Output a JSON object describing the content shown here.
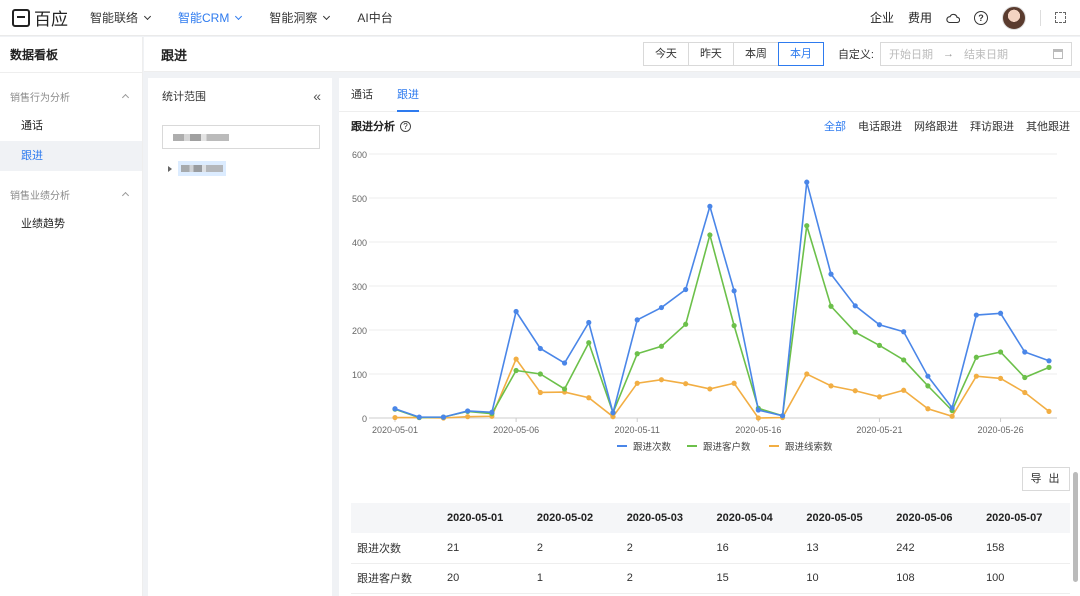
{
  "app": {
    "logo_text": "百应",
    "nav": [
      {
        "label": "智能联络",
        "active": false
      },
      {
        "label": "智能CRM",
        "active": true
      },
      {
        "label": "智能洞察",
        "active": false
      },
      {
        "label": "AI中台",
        "active": false
      }
    ],
    "right": {
      "enterprise": "企业",
      "fees": "费用",
      "help": "?"
    }
  },
  "sidebar": {
    "title": "数据看板",
    "groups": [
      {
        "label": "销售行为分析",
        "items": [
          {
            "label": "通话",
            "active": false
          },
          {
            "label": "跟进",
            "active": true
          }
        ]
      },
      {
        "label": "销售业绩分析",
        "items": [
          {
            "label": "业绩趋势",
            "active": false
          }
        ]
      }
    ]
  },
  "header": {
    "title": "跟进",
    "ranges": [
      {
        "label": "今天",
        "active": false
      },
      {
        "label": "昨天",
        "active": false
      },
      {
        "label": "本周",
        "active": false
      },
      {
        "label": "本月",
        "active": true
      }
    ],
    "custom_label": "自定义:",
    "start_placeholder": "开始日期",
    "arrow": "→",
    "end_placeholder": "结束日期"
  },
  "scope": {
    "title": "统计范围",
    "collapse": "«"
  },
  "main": {
    "tabs": [
      {
        "label": "通话",
        "active": false
      },
      {
        "label": "跟进",
        "active": true
      }
    ],
    "section_title": "跟进分析",
    "filters": [
      {
        "label": "全部",
        "active": true
      },
      {
        "label": "电话跟进",
        "active": false
      },
      {
        "label": "网络跟进",
        "active": false
      },
      {
        "label": "拜访跟进",
        "active": false
      },
      {
        "label": "其他跟进",
        "active": false
      }
    ],
    "export_label": "导 出"
  },
  "chart_data": {
    "type": "line",
    "x": [
      "2020-05-01",
      "2020-05-02",
      "2020-05-03",
      "2020-05-04",
      "2020-05-05",
      "2020-05-06",
      "2020-05-07",
      "2020-05-08",
      "2020-05-09",
      "2020-05-10",
      "2020-05-11",
      "2020-05-12",
      "2020-05-13",
      "2020-05-14",
      "2020-05-15",
      "2020-05-16",
      "2020-05-17",
      "2020-05-18",
      "2020-05-19",
      "2020-05-20",
      "2020-05-21",
      "2020-05-22",
      "2020-05-23",
      "2020-05-24",
      "2020-05-25",
      "2020-05-26",
      "2020-05-27",
      "2020-05-28"
    ],
    "x_tick_labels": [
      "2020-05-01",
      "2020-05-06",
      "2020-05-11",
      "2020-05-16",
      "2020-05-21",
      "2020-05-26"
    ],
    "series": [
      {
        "name": "跟进次数",
        "color": "#4a86e8",
        "values": [
          21,
          2,
          2,
          16,
          13,
          242,
          158,
          125,
          217,
          12,
          223,
          251,
          292,
          481,
          289,
          18,
          5,
          536,
          327,
          255,
          212,
          196,
          95,
          23,
          234,
          238,
          150,
          130
        ]
      },
      {
        "name": "跟进客户数",
        "color": "#6cc04a",
        "values": [
          20,
          1,
          2,
          15,
          10,
          108,
          100,
          66,
          171,
          12,
          146,
          163,
          213,
          416,
          210,
          22,
          5,
          437,
          254,
          195,
          165,
          132,
          73,
          17,
          138,
          150,
          92,
          115
        ]
      },
      {
        "name": "跟进线索数",
        "color": "#f2ae43",
        "values": [
          1,
          1,
          0,
          3,
          4,
          134,
          58,
          59,
          46,
          3,
          79,
          87,
          78,
          66,
          79,
          0,
          1,
          100,
          73,
          62,
          48,
          63,
          21,
          4,
          95,
          90,
          58,
          15
        ]
      }
    ],
    "ylim": [
      0,
      600
    ],
    "yticks": [
      0,
      100,
      200,
      300,
      400,
      500,
      600
    ],
    "grid": true,
    "legend_position": "bottom"
  },
  "table": {
    "headers": [
      "",
      "2020-05-01",
      "2020-05-02",
      "2020-05-03",
      "2020-05-04",
      "2020-05-05",
      "2020-05-06",
      "2020-05-07"
    ],
    "rows": [
      [
        "跟进次数",
        "21",
        "2",
        "2",
        "16",
        "13",
        "242",
        "158"
      ],
      [
        "跟进客户数",
        "20",
        "1",
        "2",
        "15",
        "10",
        "108",
        "100"
      ]
    ]
  }
}
